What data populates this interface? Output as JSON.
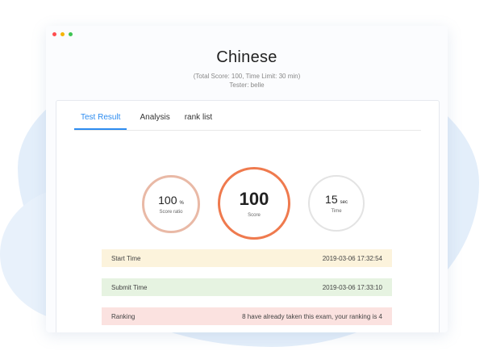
{
  "window": {
    "dots": [
      "close",
      "minimize",
      "maximize"
    ],
    "colors": {
      "close": "#ff4d4f",
      "minimize": "#f5b400",
      "maximize": "#3fc454"
    }
  },
  "header": {
    "title": "Chinese",
    "meta_line": "(Total Score: 100,   Time Limit: 30 min)",
    "tester_line": "Tester: belle"
  },
  "tabs": [
    {
      "label": "Test Result",
      "active": true
    },
    {
      "label": "Analysis",
      "active": false
    },
    {
      "label": "rank list",
      "active": false
    }
  ],
  "stats": {
    "score_ratio": {
      "value": "100",
      "unit": "%",
      "caption": "Score ratio"
    },
    "score": {
      "value": "100",
      "caption": "Score"
    },
    "time": {
      "value": "15",
      "unit": "sec",
      "caption": "Time"
    }
  },
  "rows": [
    {
      "label": "Start Time",
      "value": "2019-03-06 17:32:54"
    },
    {
      "label": "Submit Time",
      "value": "2019-03-06 17:33:10"
    },
    {
      "label": "Ranking",
      "value": "8 have already taken this exam, your ranking is 4"
    }
  ],
  "accent": "#2d8cf0"
}
